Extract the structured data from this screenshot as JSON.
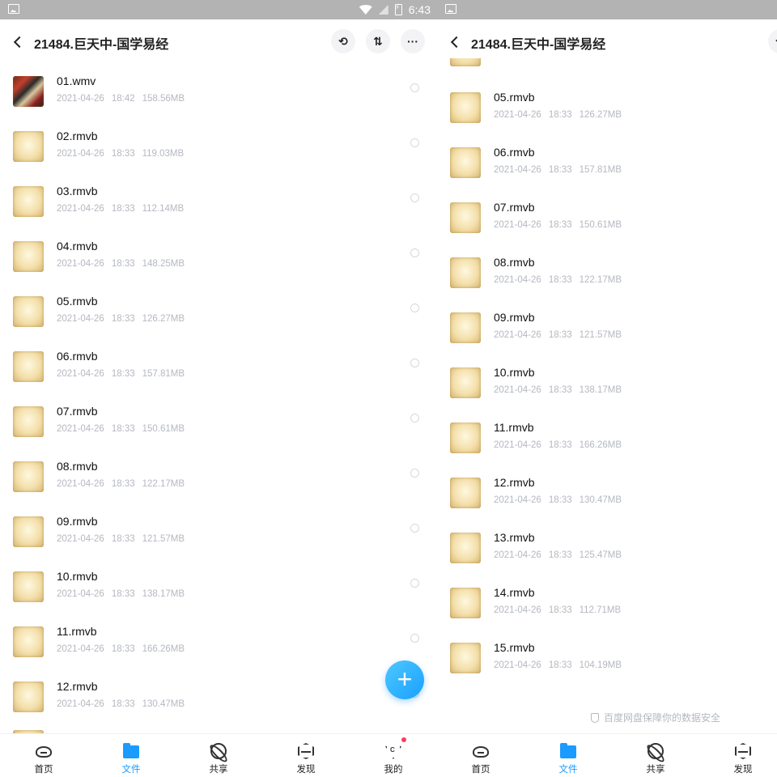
{
  "status_bar": {
    "time": "6:43"
  },
  "header": {
    "title": "21484.巨天中-国学易经"
  },
  "left_files": [
    {
      "name": "01.wmv",
      "date": "2021-04-26",
      "time": "18:42",
      "size": "158.56MB",
      "thumb": "video"
    },
    {
      "name": "02.rmvb",
      "date": "2021-04-26",
      "time": "18:33",
      "size": "119.03MB",
      "thumb": "rmvb"
    },
    {
      "name": "03.rmvb",
      "date": "2021-04-26",
      "time": "18:33",
      "size": "112.14MB",
      "thumb": "rmvb"
    },
    {
      "name": "04.rmvb",
      "date": "2021-04-26",
      "time": "18:33",
      "size": "148.25MB",
      "thumb": "rmvb"
    },
    {
      "name": "05.rmvb",
      "date": "2021-04-26",
      "time": "18:33",
      "size": "126.27MB",
      "thumb": "rmvb"
    },
    {
      "name": "06.rmvb",
      "date": "2021-04-26",
      "time": "18:33",
      "size": "157.81MB",
      "thumb": "rmvb"
    },
    {
      "name": "07.rmvb",
      "date": "2021-04-26",
      "time": "18:33",
      "size": "150.61MB",
      "thumb": "rmvb"
    },
    {
      "name": "08.rmvb",
      "date": "2021-04-26",
      "time": "18:33",
      "size": "122.17MB",
      "thumb": "rmvb"
    },
    {
      "name": "09.rmvb",
      "date": "2021-04-26",
      "time": "18:33",
      "size": "121.57MB",
      "thumb": "rmvb"
    },
    {
      "name": "10.rmvb",
      "date": "2021-04-26",
      "time": "18:33",
      "size": "138.17MB",
      "thumb": "rmvb"
    },
    {
      "name": "11.rmvb",
      "date": "2021-04-26",
      "time": "18:33",
      "size": "166.26MB",
      "thumb": "rmvb"
    },
    {
      "name": "12.rmvb",
      "date": "2021-04-26",
      "time": "18:33",
      "size": "130.47MB",
      "thumb": "rmvb"
    }
  ],
  "right_files": [
    {
      "name": "05.rmvb",
      "date": "2021-04-26",
      "time": "18:33",
      "size": "126.27MB"
    },
    {
      "name": "06.rmvb",
      "date": "2021-04-26",
      "time": "18:33",
      "size": "157.81MB"
    },
    {
      "name": "07.rmvb",
      "date": "2021-04-26",
      "time": "18:33",
      "size": "150.61MB"
    },
    {
      "name": "08.rmvb",
      "date": "2021-04-26",
      "time": "18:33",
      "size": "122.17MB"
    },
    {
      "name": "09.rmvb",
      "date": "2021-04-26",
      "time": "18:33",
      "size": "121.57MB"
    },
    {
      "name": "10.rmvb",
      "date": "2021-04-26",
      "time": "18:33",
      "size": "138.17MB"
    },
    {
      "name": "11.rmvb",
      "date": "2021-04-26",
      "time": "18:33",
      "size": "166.26MB"
    },
    {
      "name": "12.rmvb",
      "date": "2021-04-26",
      "time": "18:33",
      "size": "130.47MB"
    },
    {
      "name": "13.rmvb",
      "date": "2021-04-26",
      "time": "18:33",
      "size": "125.47MB"
    },
    {
      "name": "14.rmvb",
      "date": "2021-04-26",
      "time": "18:33",
      "size": "112.71MB"
    },
    {
      "name": "15.rmvb",
      "date": "2021-04-26",
      "time": "18:33",
      "size": "104.19MB"
    }
  ],
  "footer_note": "百度网盘保障你的数据安全",
  "tabs": [
    {
      "label": "首页",
      "icon": "cloud-home-icon"
    },
    {
      "label": "文件",
      "icon": "folder-icon",
      "active": true
    },
    {
      "label": "共享",
      "icon": "atom-share-icon"
    },
    {
      "label": "发现",
      "icon": "cube-discover-icon"
    },
    {
      "label": "我的",
      "icon": "diamond-profile-icon",
      "badge": true
    }
  ],
  "fab": {
    "symbol": "+"
  },
  "colors": {
    "accent": "#1a9bff",
    "meta_text": "#b4b8c0",
    "status_bar": "#b3b3b3",
    "badge": "#ff3b5c"
  }
}
